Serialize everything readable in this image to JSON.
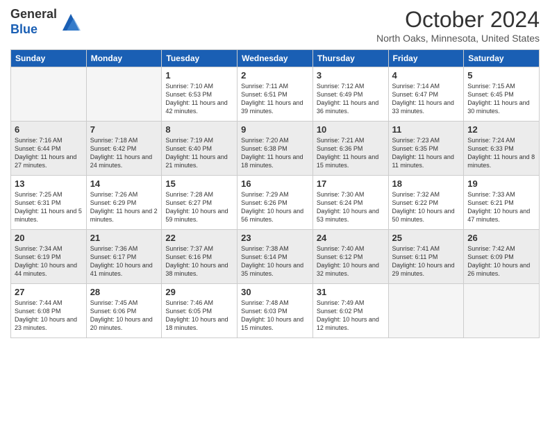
{
  "header": {
    "logo_line1": "General",
    "logo_line2": "Blue",
    "month_title": "October 2024",
    "location": "North Oaks, Minnesota, United States"
  },
  "days_of_week": [
    "Sunday",
    "Monday",
    "Tuesday",
    "Wednesday",
    "Thursday",
    "Friday",
    "Saturday"
  ],
  "weeks": [
    [
      {
        "day": "",
        "info": ""
      },
      {
        "day": "",
        "info": ""
      },
      {
        "day": "1",
        "info": "Sunrise: 7:10 AM\nSunset: 6:53 PM\nDaylight: 11 hours and 42 minutes."
      },
      {
        "day": "2",
        "info": "Sunrise: 7:11 AM\nSunset: 6:51 PM\nDaylight: 11 hours and 39 minutes."
      },
      {
        "day": "3",
        "info": "Sunrise: 7:12 AM\nSunset: 6:49 PM\nDaylight: 11 hours and 36 minutes."
      },
      {
        "day": "4",
        "info": "Sunrise: 7:14 AM\nSunset: 6:47 PM\nDaylight: 11 hours and 33 minutes."
      },
      {
        "day": "5",
        "info": "Sunrise: 7:15 AM\nSunset: 6:45 PM\nDaylight: 11 hours and 30 minutes."
      }
    ],
    [
      {
        "day": "6",
        "info": "Sunrise: 7:16 AM\nSunset: 6:44 PM\nDaylight: 11 hours and 27 minutes."
      },
      {
        "day": "7",
        "info": "Sunrise: 7:18 AM\nSunset: 6:42 PM\nDaylight: 11 hours and 24 minutes."
      },
      {
        "day": "8",
        "info": "Sunrise: 7:19 AM\nSunset: 6:40 PM\nDaylight: 11 hours and 21 minutes."
      },
      {
        "day": "9",
        "info": "Sunrise: 7:20 AM\nSunset: 6:38 PM\nDaylight: 11 hours and 18 minutes."
      },
      {
        "day": "10",
        "info": "Sunrise: 7:21 AM\nSunset: 6:36 PM\nDaylight: 11 hours and 15 minutes."
      },
      {
        "day": "11",
        "info": "Sunrise: 7:23 AM\nSunset: 6:35 PM\nDaylight: 11 hours and 11 minutes."
      },
      {
        "day": "12",
        "info": "Sunrise: 7:24 AM\nSunset: 6:33 PM\nDaylight: 11 hours and 8 minutes."
      }
    ],
    [
      {
        "day": "13",
        "info": "Sunrise: 7:25 AM\nSunset: 6:31 PM\nDaylight: 11 hours and 5 minutes."
      },
      {
        "day": "14",
        "info": "Sunrise: 7:26 AM\nSunset: 6:29 PM\nDaylight: 11 hours and 2 minutes."
      },
      {
        "day": "15",
        "info": "Sunrise: 7:28 AM\nSunset: 6:27 PM\nDaylight: 10 hours and 59 minutes."
      },
      {
        "day": "16",
        "info": "Sunrise: 7:29 AM\nSunset: 6:26 PM\nDaylight: 10 hours and 56 minutes."
      },
      {
        "day": "17",
        "info": "Sunrise: 7:30 AM\nSunset: 6:24 PM\nDaylight: 10 hours and 53 minutes."
      },
      {
        "day": "18",
        "info": "Sunrise: 7:32 AM\nSunset: 6:22 PM\nDaylight: 10 hours and 50 minutes."
      },
      {
        "day": "19",
        "info": "Sunrise: 7:33 AM\nSunset: 6:21 PM\nDaylight: 10 hours and 47 minutes."
      }
    ],
    [
      {
        "day": "20",
        "info": "Sunrise: 7:34 AM\nSunset: 6:19 PM\nDaylight: 10 hours and 44 minutes."
      },
      {
        "day": "21",
        "info": "Sunrise: 7:36 AM\nSunset: 6:17 PM\nDaylight: 10 hours and 41 minutes."
      },
      {
        "day": "22",
        "info": "Sunrise: 7:37 AM\nSunset: 6:16 PM\nDaylight: 10 hours and 38 minutes."
      },
      {
        "day": "23",
        "info": "Sunrise: 7:38 AM\nSunset: 6:14 PM\nDaylight: 10 hours and 35 minutes."
      },
      {
        "day": "24",
        "info": "Sunrise: 7:40 AM\nSunset: 6:12 PM\nDaylight: 10 hours and 32 minutes."
      },
      {
        "day": "25",
        "info": "Sunrise: 7:41 AM\nSunset: 6:11 PM\nDaylight: 10 hours and 29 minutes."
      },
      {
        "day": "26",
        "info": "Sunrise: 7:42 AM\nSunset: 6:09 PM\nDaylight: 10 hours and 26 minutes."
      }
    ],
    [
      {
        "day": "27",
        "info": "Sunrise: 7:44 AM\nSunset: 6:08 PM\nDaylight: 10 hours and 23 minutes."
      },
      {
        "day": "28",
        "info": "Sunrise: 7:45 AM\nSunset: 6:06 PM\nDaylight: 10 hours and 20 minutes."
      },
      {
        "day": "29",
        "info": "Sunrise: 7:46 AM\nSunset: 6:05 PM\nDaylight: 10 hours and 18 minutes."
      },
      {
        "day": "30",
        "info": "Sunrise: 7:48 AM\nSunset: 6:03 PM\nDaylight: 10 hours and 15 minutes."
      },
      {
        "day": "31",
        "info": "Sunrise: 7:49 AM\nSunset: 6:02 PM\nDaylight: 10 hours and 12 minutes."
      },
      {
        "day": "",
        "info": ""
      },
      {
        "day": "",
        "info": ""
      }
    ]
  ]
}
